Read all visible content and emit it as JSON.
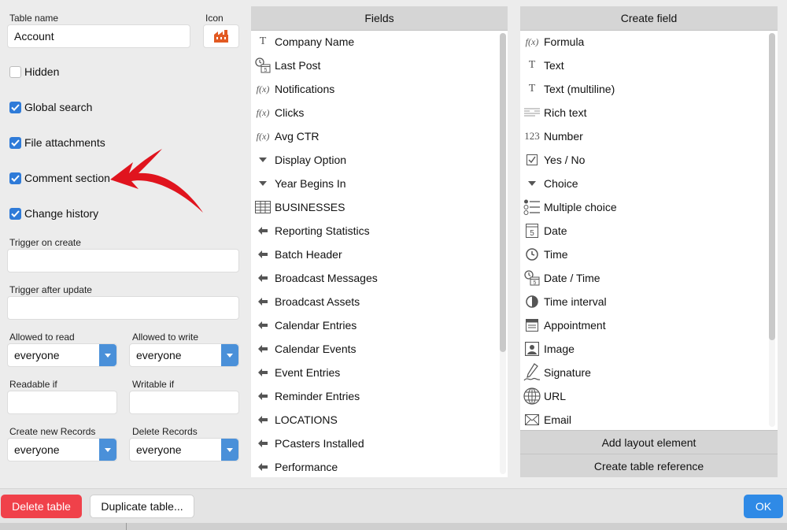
{
  "table": {
    "name_label": "Table name",
    "name_value": "Account",
    "icon_label": "Icon"
  },
  "options": [
    {
      "label": "Hidden",
      "checked": false
    },
    {
      "label": "Global search",
      "checked": true
    },
    {
      "label": "File attachments",
      "checked": true
    },
    {
      "label": "Comment section",
      "checked": true
    },
    {
      "label": "Change history",
      "checked": true
    }
  ],
  "triggers": {
    "on_create_label": "Trigger on create",
    "on_create_value": "",
    "after_update_label": "Trigger after update",
    "after_update_value": ""
  },
  "permissions": {
    "read_label": "Allowed to read",
    "read_value": "everyone",
    "write_label": "Allowed to write",
    "write_value": "everyone",
    "readable_if_label": "Readable if",
    "writable_if_label": "Writable if",
    "create_label": "Create new Records",
    "create_value": "everyone",
    "delete_label": "Delete Records",
    "delete_value": "everyone"
  },
  "fields_panel": {
    "title": "Fields",
    "items": [
      {
        "icon": "text-icon",
        "label": "Company Name"
      },
      {
        "icon": "datetime-icon",
        "label": "Last Post"
      },
      {
        "icon": "formula-icon",
        "label": "Notifications"
      },
      {
        "icon": "formula-icon",
        "label": "Clicks"
      },
      {
        "icon": "formula-icon",
        "label": "Avg CTR"
      },
      {
        "icon": "choice-triangle-icon",
        "label": "Display Option"
      },
      {
        "icon": "choice-triangle-icon",
        "label": "Year Begins In"
      },
      {
        "icon": "table-grid-icon",
        "label": "BUSINESSES"
      },
      {
        "icon": "reference-arrow-icon",
        "label": "Reporting Statistics"
      },
      {
        "icon": "reference-arrow-icon",
        "label": "Batch Header"
      },
      {
        "icon": "reference-arrow-icon",
        "label": "Broadcast Messages"
      },
      {
        "icon": "reference-arrow-icon",
        "label": "Broadcast Assets"
      },
      {
        "icon": "reference-arrow-icon",
        "label": "Calendar Entries"
      },
      {
        "icon": "reference-arrow-icon",
        "label": "Calendar Events"
      },
      {
        "icon": "reference-arrow-icon",
        "label": "Event Entries"
      },
      {
        "icon": "reference-arrow-icon",
        "label": "Reminder Entries"
      },
      {
        "icon": "reference-arrow-icon",
        "label": "LOCATIONS"
      },
      {
        "icon": "reference-arrow-icon",
        "label": "PCasters Installed"
      },
      {
        "icon": "reference-arrow-icon",
        "label": "Performance"
      }
    ]
  },
  "create_panel": {
    "title": "Create field",
    "items": [
      {
        "icon": "formula-icon",
        "label": "Formula"
      },
      {
        "icon": "text-icon",
        "label": "Text"
      },
      {
        "icon": "text-icon",
        "label": "Text (multiline)"
      },
      {
        "icon": "rich-text-icon",
        "label": "Rich text"
      },
      {
        "icon": "number-icon",
        "label": "Number"
      },
      {
        "icon": "checkbox-icon",
        "label": "Yes / No"
      },
      {
        "icon": "choice-triangle-icon",
        "label": "Choice"
      },
      {
        "icon": "multiple-choice-icon",
        "label": "Multiple choice"
      },
      {
        "icon": "calendar-icon",
        "label": "Date"
      },
      {
        "icon": "clock-icon",
        "label": "Time"
      },
      {
        "icon": "datetime-icon",
        "label": "Date / Time"
      },
      {
        "icon": "time-interval-icon",
        "label": "Time interval"
      },
      {
        "icon": "appointment-icon",
        "label": "Appointment"
      },
      {
        "icon": "image-icon",
        "label": "Image"
      },
      {
        "icon": "signature-icon",
        "label": "Signature"
      },
      {
        "icon": "globe-icon",
        "label": "URL"
      },
      {
        "icon": "envelope-icon",
        "label": "Email"
      }
    ],
    "add_layout_label": "Add layout element",
    "create_reference_label": "Create table reference"
  },
  "footer": {
    "delete_label": "Delete table",
    "duplicate_label": "Duplicate table...",
    "ok_label": "OK"
  },
  "colors": {
    "accent": "#2f7bd8",
    "danger": "#f0414a",
    "annotation": "#e0141e"
  }
}
